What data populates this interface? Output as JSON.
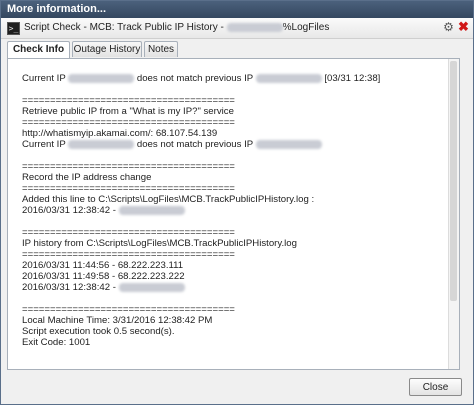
{
  "dialog": {
    "title": "More information..."
  },
  "check": {
    "title_prefix": "Script Check - MCB: Track Public IP History - ",
    "title_suffix": "%LogFiles"
  },
  "tabs": [
    {
      "label": "Check Info",
      "active": true
    },
    {
      "label": "Outage History",
      "active": false
    },
    {
      "label": "Notes",
      "active": false
    }
  ],
  "log": {
    "current_ip_prefix": "Current IP",
    "mismatch_text": "does not match previous IP",
    "timestamp_1": "[03/31 12:38]",
    "separator": "======================================",
    "retrieve_heading": "Retrieve public IP from a \"What is my IP?\" service",
    "whatismyip_line": "http://whatismyip.akamai.com/: 68.107.54.139",
    "record_heading": "Record the IP address change",
    "added_line": "Added this line to C:\\Scripts\\LogFiles\\MCB.TrackPublicIPHistory.log :",
    "added_entry": "2016/03/31 12:38:42 -",
    "history_heading": "IP history from C:\\Scripts\\LogFiles\\MCB.TrackPublicIPHistory.log",
    "history": [
      "2016/03/31 11:44:56 - 68.222.223.111",
      "2016/03/31 11:49:58 - 68.222.223.222",
      "2016/03/31 12:38:42 -"
    ],
    "local_time": "Local Machine Time: 3/31/2016 12:38:42 PM",
    "exec_time": "Script execution took 0.5 second(s).",
    "exit_code": "Exit Code: 1001"
  },
  "buttons": {
    "close": "Close"
  },
  "icons": {
    "terminal": "terminal-icon",
    "edit": "edit-icon",
    "delete": "delete-icon"
  },
  "colors": {
    "titlebar": "#3d5170",
    "delete_icon": "#d01818"
  }
}
